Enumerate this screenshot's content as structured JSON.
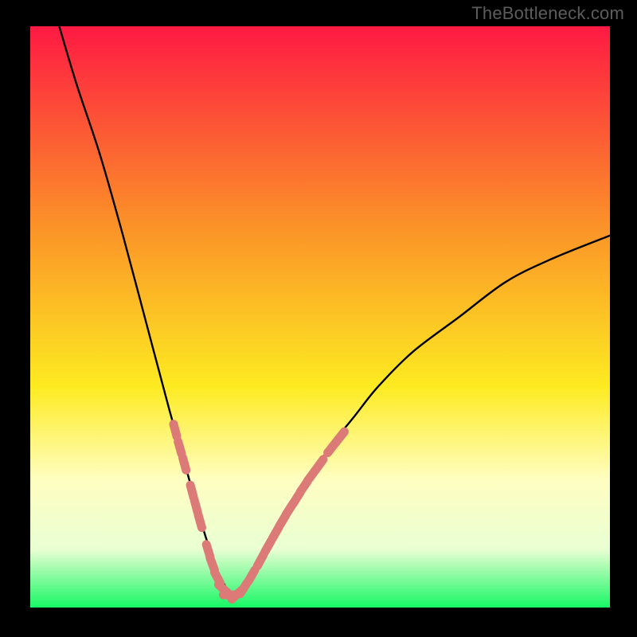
{
  "watermark": "TheBottleneck.com",
  "colors": {
    "bg": "#000000",
    "gradient_top": "#fe1a43",
    "gradient_mid1": "#fb9128",
    "gradient_mid2": "#fdeb21",
    "gradient_low1": "#fffec1",
    "gradient_low2": "#e9ffd3",
    "gradient_bottom": "#17f765",
    "curve": "#000000",
    "marker_fill": "#db7a77",
    "marker_stroke": "#db7a77"
  },
  "chart_data": {
    "type": "line",
    "title": "",
    "xlabel": "",
    "ylabel": "",
    "xlim": [
      0,
      100
    ],
    "ylim": [
      0,
      100
    ],
    "curve": {
      "name": "bottleneck-curve",
      "x": [
        5,
        8,
        12,
        16,
        20,
        24,
        26,
        28,
        30,
        31,
        32,
        33,
        34,
        35,
        36,
        37,
        38,
        40,
        42,
        44,
        48,
        52,
        56,
        60,
        66,
        74,
        82,
        90,
        100
      ],
      "y": [
        100,
        90,
        78,
        64,
        49,
        34,
        27,
        20,
        13,
        10,
        7,
        5,
        3,
        2,
        2,
        3,
        5,
        8,
        12,
        16,
        22,
        28,
        33,
        38,
        44,
        50,
        56,
        60,
        64
      ]
    },
    "markers": [
      {
        "x": 25.0,
        "y": 30.5
      },
      {
        "x": 25.8,
        "y": 27.5
      },
      {
        "x": 26.6,
        "y": 24.7
      },
      {
        "x": 27.9,
        "y": 20.0
      },
      {
        "x": 28.6,
        "y": 17.4
      },
      {
        "x": 29.3,
        "y": 14.8
      },
      {
        "x": 30.7,
        "y": 9.8
      },
      {
        "x": 31.4,
        "y": 7.5
      },
      {
        "x": 32.3,
        "y": 5.1
      },
      {
        "x": 33.3,
        "y": 3.2
      },
      {
        "x": 34.4,
        "y": 2.2
      },
      {
        "x": 35.6,
        "y": 2.2
      },
      {
        "x": 36.8,
        "y": 3.3
      },
      {
        "x": 38.2,
        "y": 5.5
      },
      {
        "x": 39.7,
        "y": 8.1
      },
      {
        "x": 41.0,
        "y": 10.5
      },
      {
        "x": 42.3,
        "y": 12.8
      },
      {
        "x": 43.5,
        "y": 14.9
      },
      {
        "x": 44.7,
        "y": 16.9
      },
      {
        "x": 46.0,
        "y": 18.9
      },
      {
        "x": 47.2,
        "y": 20.8
      },
      {
        "x": 48.5,
        "y": 22.7
      },
      {
        "x": 49.9,
        "y": 24.6
      },
      {
        "x": 52.0,
        "y": 27.5
      },
      {
        "x": 53.5,
        "y": 29.4
      }
    ]
  }
}
